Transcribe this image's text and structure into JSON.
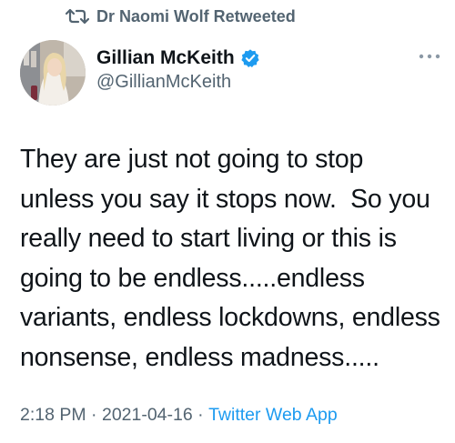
{
  "retweet": {
    "text": "Dr Naomi Wolf Retweeted",
    "icon": "retweet-icon"
  },
  "author": {
    "name": "Gillian McKeith",
    "handle": "@GillianMcKeith",
    "verified_icon": "verified-badge-icon",
    "avatar": "profile-photo"
  },
  "more_icon": "more-options-icon",
  "tweet": {
    "lines": [
      "They are just not going to stop",
      "unless you say it stops now.  So you",
      "really need to start living or this is",
      "going to be endless.....endless",
      "variants, endless lockdowns, endless",
      "nonsense, endless madness....."
    ]
  },
  "meta": {
    "time": "2:18 PM",
    "separator": " · ",
    "date": "2021-04-16",
    "source": "Twitter Web App"
  },
  "colors": {
    "text": "#0f1419",
    "secondary": "#536471",
    "accent": "#1d9bf0"
  }
}
